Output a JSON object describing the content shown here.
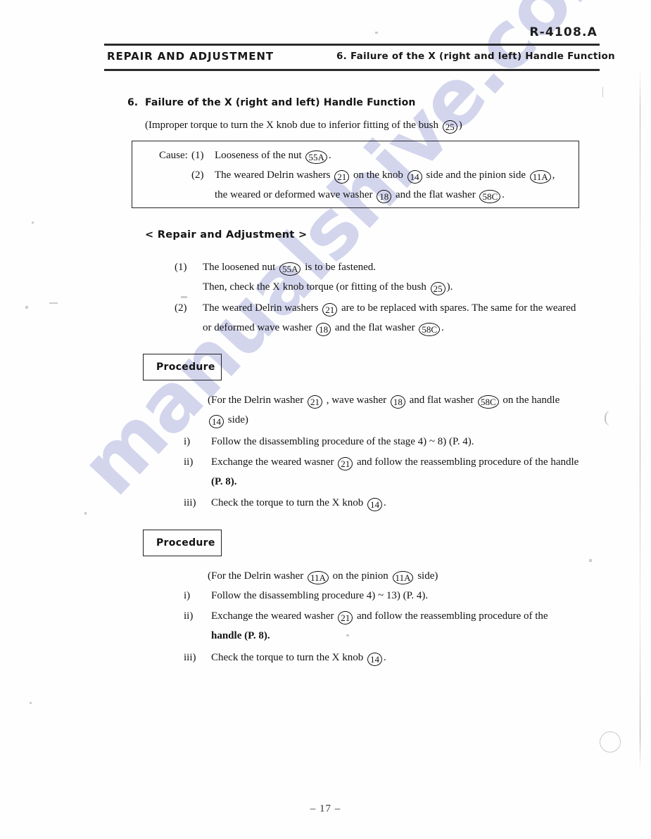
{
  "document": {
    "code": "R-4108.A",
    "page_number": "– 17 –",
    "watermark_text": "manualshive.com"
  },
  "header": {
    "left": "REPAIR  AND  ADJUSTMENT",
    "right": "6. Failure of the X (right and left) Handle Function"
  },
  "section": {
    "number": "6.",
    "title": "Failure of the X (right and left) Handle Function",
    "subtitle_before": "(Improper torque to turn the X knob due to inferior fitting of the bush",
    "subtitle_part": "25",
    "subtitle_after": ")"
  },
  "cause_box": {
    "label": "Cause:",
    "items": [
      {
        "marker": "(1)",
        "lines": [
          {
            "segments": [
              {
                "text": "Looseness of the nut"
              },
              {
                "part": "55A",
                "wide": true
              },
              {
                "text": "."
              }
            ]
          }
        ]
      },
      {
        "marker": "(2)",
        "lines": [
          {
            "segments": [
              {
                "text": "The weared Delrin washers"
              },
              {
                "part": "21"
              },
              {
                "text": "on the knob"
              },
              {
                "part": "14"
              },
              {
                "text": "side and the pinion side"
              },
              {
                "part": "11A",
                "wide": true
              },
              {
                "text": ","
              }
            ]
          },
          {
            "segments": [
              {
                "text": "the weared or deformed wave washer"
              },
              {
                "part": "18"
              },
              {
                "text": "and the flat washer"
              },
              {
                "part": "58C",
                "wide": true
              },
              {
                "text": "."
              }
            ]
          }
        ]
      }
    ]
  },
  "repair_heading": "< Repair and Adjustment >",
  "repair_items": [
    {
      "marker": "(1)",
      "lines": [
        {
          "segments": [
            {
              "text": "The loosened nut"
            },
            {
              "part": "55A",
              "wide": true
            },
            {
              "text": "is to be fastened."
            }
          ]
        },
        {
          "segments": [
            {
              "text": "Then, check the X knob torque (or fitting of the bush"
            },
            {
              "part": "25"
            },
            {
              "text": ")."
            }
          ]
        }
      ]
    },
    {
      "marker": "(2)",
      "lines": [
        {
          "segments": [
            {
              "text": "The weared Delrin washers"
            },
            {
              "part": "21"
            },
            {
              "text": "are to be replaced with spares.  The same for the weared"
            }
          ]
        },
        {
          "segments": [
            {
              "text": "or deformed wave washer"
            },
            {
              "part": "18"
            },
            {
              "text": "and the flat washer"
            },
            {
              "part": "58C",
              "wide": true
            },
            {
              "text": "."
            }
          ]
        }
      ]
    }
  ],
  "procedures": [
    {
      "box_label": "Procedure",
      "scope_lines": [
        {
          "segments": [
            {
              "text": "(For the Delrin washer"
            },
            {
              "part": "21"
            },
            {
              "text": ",  wave washer"
            },
            {
              "part": "18"
            },
            {
              "text": "and flat washer"
            },
            {
              "part": "58C",
              "wide": true
            },
            {
              "text": "on the handle"
            }
          ]
        },
        {
          "segments": [
            {
              "part": "14"
            },
            {
              "text": "side)"
            }
          ]
        }
      ],
      "steps": [
        {
          "marker": "i)",
          "lines": [
            {
              "segments": [
                {
                  "text": "Follow the disassembling procedure of the stage 4) ~ 8)  (P. 4)."
                }
              ]
            }
          ]
        },
        {
          "marker": "ii)",
          "lines": [
            {
              "segments": [
                {
                  "text": "Exchange the weared wasner"
                },
                {
                  "part": "21"
                },
                {
                  "text": "and follow the reassembling procedure of the handle"
                }
              ]
            },
            {
              "segments": [
                {
                  "text": "(P. 8).",
                  "bold": true
                }
              ]
            }
          ]
        },
        {
          "marker": "iii)",
          "lines": [
            {
              "segments": [
                {
                  "text": "Check the torque to turn the X knob"
                },
                {
                  "part": "14"
                },
                {
                  "text": "."
                }
              ]
            }
          ]
        }
      ]
    },
    {
      "box_label": "Procedure",
      "scope_lines": [
        {
          "segments": [
            {
              "text": "(For the Delrin washer"
            },
            {
              "part": "11A",
              "wide": true
            },
            {
              "text": "on the pinion"
            },
            {
              "part": "11A",
              "wide": true
            },
            {
              "text": "side)"
            }
          ]
        }
      ],
      "steps": [
        {
          "marker": "i)",
          "lines": [
            {
              "segments": [
                {
                  "text": "Follow the disassembling procedure 4) ~ 13) (P. 4)."
                }
              ]
            }
          ]
        },
        {
          "marker": "ii)",
          "lines": [
            {
              "segments": [
                {
                  "text": "Exchange the weared washer"
                },
                {
                  "part": "21"
                },
                {
                  "text": "and follow the reassembling procedure of the"
                }
              ]
            },
            {
              "segments": [
                {
                  "text": "handle  (P. 8).",
                  "bold": true
                }
              ]
            }
          ]
        },
        {
          "marker": "iii)",
          "lines": [
            {
              "segments": [
                {
                  "text": "Check the torque to turn the X knob"
                },
                {
                  "part": "14"
                },
                {
                  "text": "."
                }
              ]
            }
          ]
        }
      ]
    }
  ],
  "colors": {
    "ink": "#141414",
    "watermark": "#b9bde4",
    "paper": "#fefefe"
  }
}
